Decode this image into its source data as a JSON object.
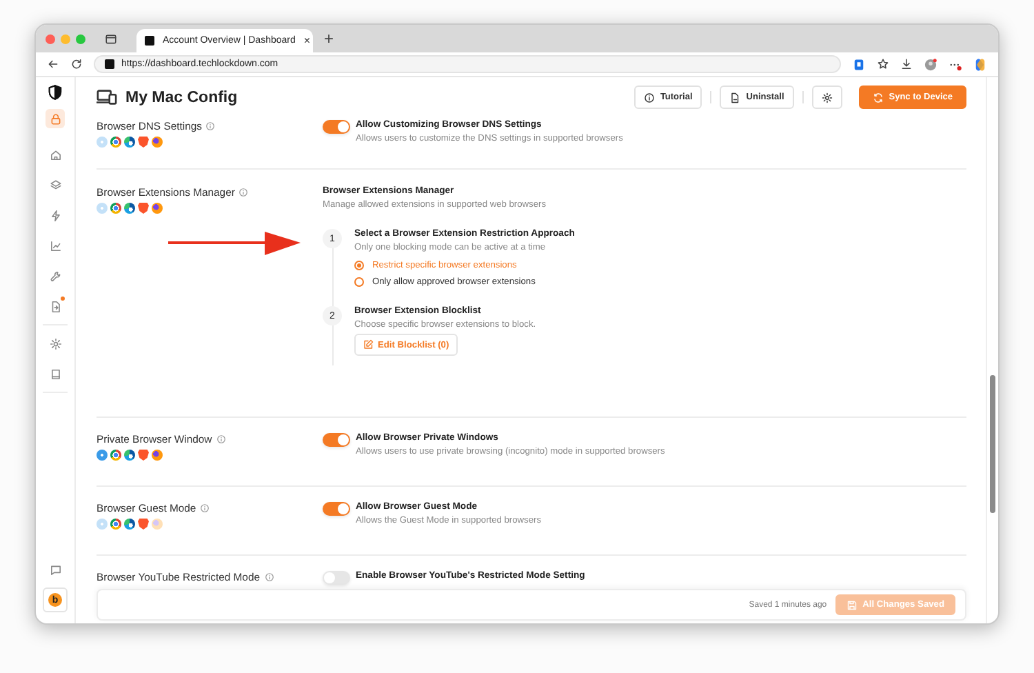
{
  "browser": {
    "tab_title": "Account Overview | Dashboard",
    "tab_close": "×",
    "new_tab": "+",
    "url": "https://dashboard.techlockdown.com"
  },
  "sidebar": {
    "groups": [
      {
        "items": [
          {
            "kind": "lock",
            "selected": true,
            "badge": false
          }
        ]
      },
      {
        "items": [
          {
            "kind": "home",
            "selected": false,
            "badge": false
          },
          {
            "kind": "layers",
            "selected": false,
            "badge": false
          },
          {
            "kind": "bolt",
            "selected": false,
            "badge": false
          },
          {
            "kind": "chart",
            "selected": false,
            "badge": false
          },
          {
            "kind": "wrench",
            "selected": false,
            "badge": false
          },
          {
            "kind": "document",
            "selected": false,
            "badge": true
          }
        ]
      },
      {
        "items": [
          {
            "kind": "gear",
            "selected": false,
            "badge": false
          },
          {
            "kind": "book",
            "selected": false,
            "badge": false
          }
        ]
      }
    ],
    "avatar": "b"
  },
  "header": {
    "title": "My Mac Config",
    "buttons": [
      {
        "kind": "tutorial",
        "label": "Tutorial"
      },
      {
        "kind": "uninstall",
        "label": "Uninstall"
      },
      {
        "kind": "settings"
      },
      {
        "kind": "sync",
        "label": "Sync to Device"
      }
    ]
  },
  "settings": [
    {
      "kind": "toggle",
      "label": "Browser DNS Settings",
      "browsers": [
        {
          "kind": "safari",
          "supported": false
        },
        {
          "kind": "chrome",
          "supported": true
        },
        {
          "kind": "edge",
          "supported": true
        },
        {
          "kind": "brave",
          "supported": true
        },
        {
          "kind": "firefox",
          "supported": true
        }
      ],
      "toggle": {
        "on": true,
        "title": "Allow Customizing Browser DNS Settings",
        "description": "Allows users to customize the DNS settings in supported browsers"
      }
    },
    {
      "kind": "steps",
      "label": "Browser Extensions Manager",
      "browsers": [
        {
          "kind": "safari",
          "supported": false
        },
        {
          "kind": "chrome",
          "supported": true
        },
        {
          "kind": "edge",
          "supported": true
        },
        {
          "kind": "brave",
          "supported": true
        },
        {
          "kind": "firefox",
          "supported": true
        }
      ],
      "title": "Browser Extensions Manager",
      "description": "Manage allowed extensions in supported web browsers",
      "steps": [
        {
          "number": "1",
          "title": "Select a Browser Extension Restriction Approach",
          "description": "Only one blocking mode can be active at a time",
          "options": [
            {
              "label": "Restrict specific browser extensions",
              "selected": true
            },
            {
              "label": "Only allow approved browser extensions",
              "selected": false
            }
          ]
        },
        {
          "number": "2",
          "title": "Browser Extension Blocklist",
          "description": "Choose specific browser extensions to block.",
          "button": "Edit Blocklist (0)"
        }
      ]
    },
    {
      "kind": "toggle",
      "label": "Private Browser Window",
      "browsers": [
        {
          "kind": "safari",
          "supported": true
        },
        {
          "kind": "chrome",
          "supported": true
        },
        {
          "kind": "edge",
          "supported": true
        },
        {
          "kind": "brave",
          "supported": true
        },
        {
          "kind": "firefox",
          "supported": true
        }
      ],
      "toggle": {
        "on": true,
        "title": "Allow Browser Private Windows",
        "description": "Allows users to use private browsing (incognito) mode in supported browsers"
      }
    },
    {
      "kind": "toggle",
      "label": "Browser Guest Mode",
      "browsers": [
        {
          "kind": "safari",
          "supported": false
        },
        {
          "kind": "chrome",
          "supported": true
        },
        {
          "kind": "edge",
          "supported": true
        },
        {
          "kind": "brave",
          "supported": true
        },
        {
          "kind": "firefox",
          "supported": false
        }
      ],
      "toggle": {
        "on": true,
        "title": "Allow Browser Guest Mode",
        "description": "Allows the Guest Mode in supported browsers"
      }
    },
    {
      "kind": "toggle",
      "label": "Browser YouTube Restricted Mode",
      "toggle": {
        "on": false,
        "title": "Enable Browser YouTube's Restricted Mode Setting"
      }
    }
  ],
  "footer": {
    "status": "Saved 1 minutes ago",
    "button": {
      "label": "All Changes Saved",
      "disabled": true
    }
  }
}
